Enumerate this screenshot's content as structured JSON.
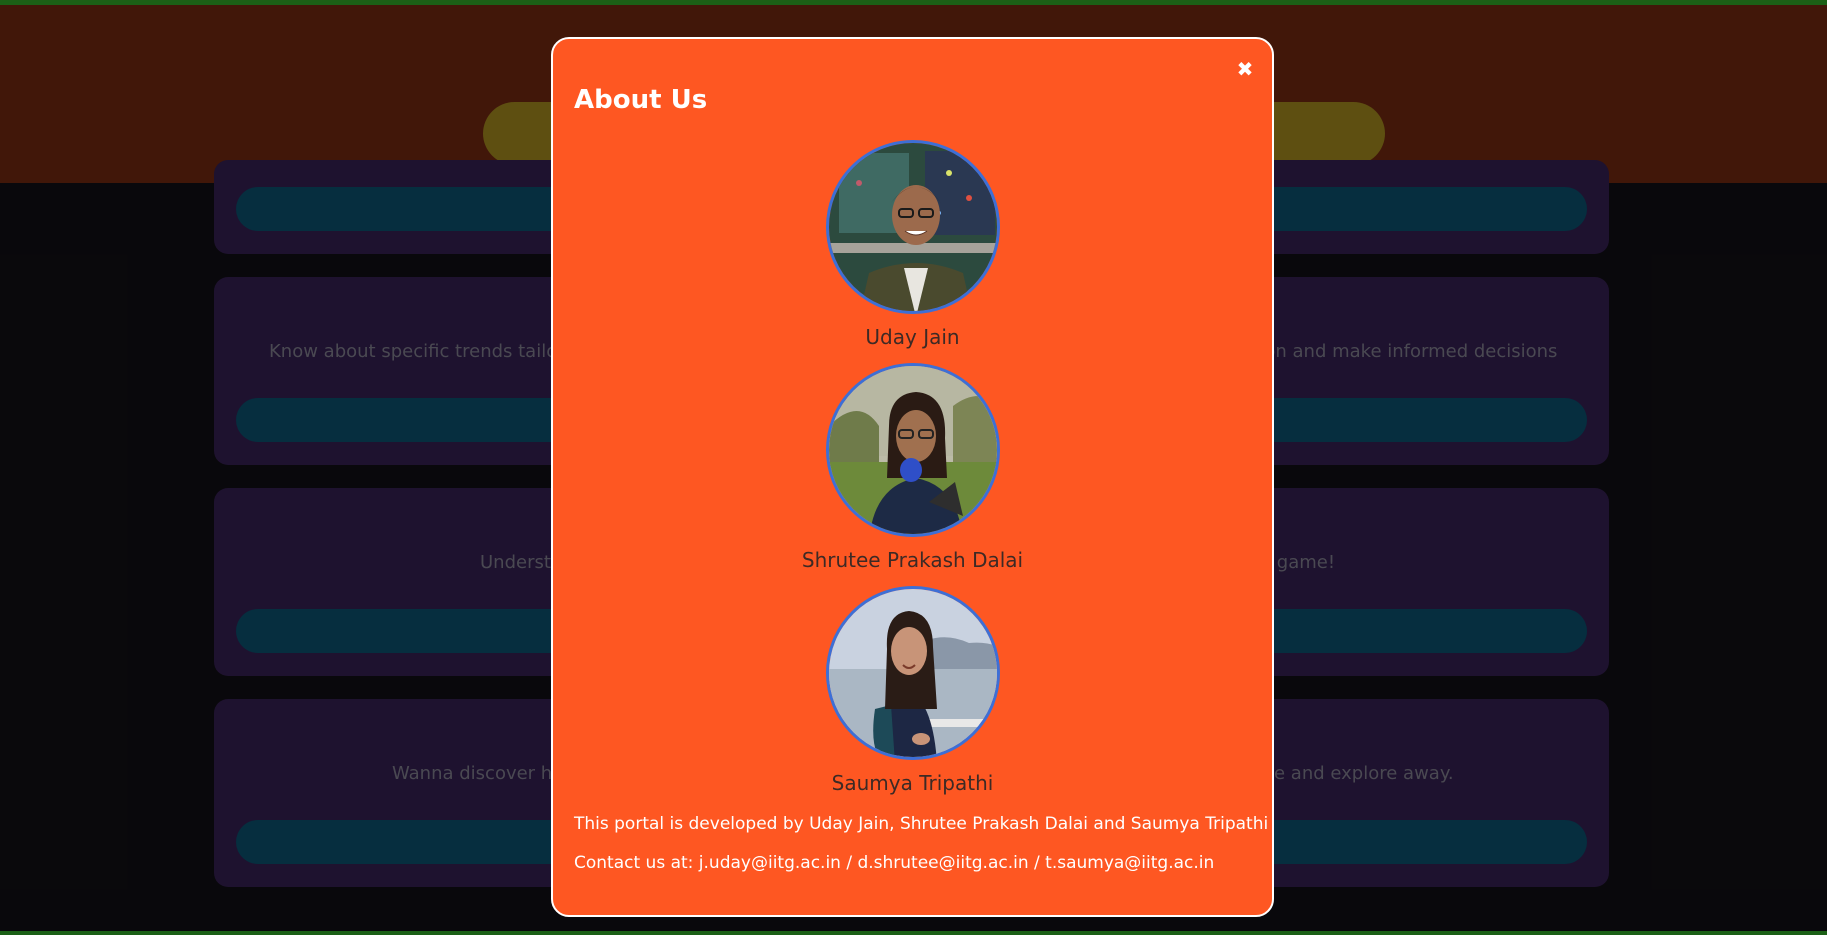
{
  "background_cards": [
    {
      "desc_left": "",
      "desc_right": ""
    },
    {
      "desc_left": "Know about specific trends tailore",
      "desc_right": "sion and make informed decisions"
    },
    {
      "desc_left": "Underst",
      "desc_right": "e game!"
    },
    {
      "desc_left": "Wanna discover ho",
      "desc_right": "e and explore away."
    }
  ],
  "modal": {
    "title": "About Us",
    "close_icon": "✖",
    "people": [
      {
        "name": "Uday Jain"
      },
      {
        "name": "Shrutee Prakash Dalai"
      },
      {
        "name": "Saumya Tripathi"
      }
    ],
    "developed_by": "This portal is developed by Uday Jain, Shrutee Prakash Dalai and Saumya Tripathi",
    "contact": "Contact us at: j.uday@iitg.ac.in / d.shrutee@iitg.ac.in / t.saumya@iitg.ac.in"
  },
  "colors": {
    "modal_bg": "#fe5722",
    "header_bg": "#4a1b0b",
    "card_bg": "#231536",
    "card_bar": "#073548",
    "photo_border": "#3d6fd6"
  }
}
